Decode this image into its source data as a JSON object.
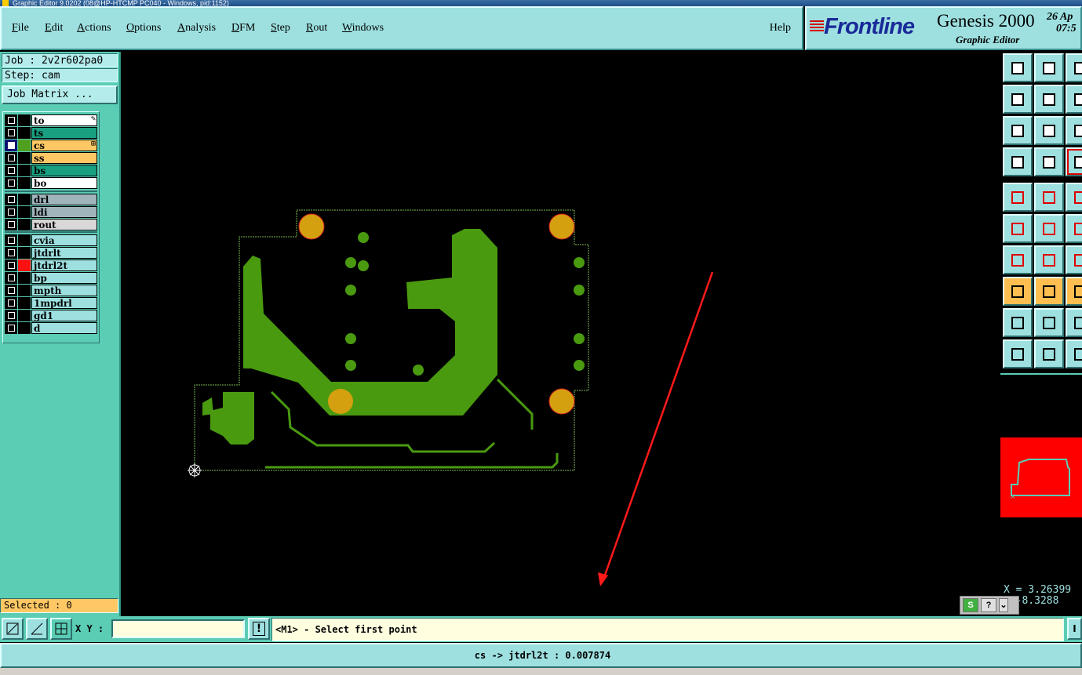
{
  "window": {
    "title": "Graphic Editor 9.0202 (08@HP-HTCMP PC040 - Windows, pid:1152)"
  },
  "menu": {
    "items": [
      "File",
      "Edit",
      "Actions",
      "Options",
      "Analysis",
      "DFM",
      "Step",
      "Rout",
      "Windows"
    ],
    "help": "Help"
  },
  "brand": {
    "logo": "Frontline",
    "title": "Genesis 2000",
    "subtitle": "Graphic Editor",
    "date": "26 Ap",
    "time": "07:5"
  },
  "job": {
    "job_line": "Job : 2v2r602pa0",
    "step_line": "Step: cam",
    "matrix_button": "Job Matrix ..."
  },
  "layers": {
    "group1": [
      {
        "name": "to",
        "bg": "#ffffff",
        "color": "#000000",
        "checked": false,
        "mark": "✎"
      },
      {
        "name": "ts",
        "bg": "#18a080",
        "color": "#000000",
        "checked": false,
        "mark": ""
      },
      {
        "name": "cs",
        "bg": "#ffc864",
        "color": "#50a020",
        "checked": true,
        "mark": "⊞"
      },
      {
        "name": "ss",
        "bg": "#ffc864",
        "color": "#000000",
        "checked": false,
        "mark": ""
      },
      {
        "name": "bs",
        "bg": "#18a080",
        "color": "#000000",
        "checked": false,
        "mark": ""
      },
      {
        "name": "bo",
        "bg": "#ffffff",
        "color": "#000000",
        "checked": false,
        "mark": ""
      }
    ],
    "group2": [
      {
        "name": "drl",
        "bg": "#a0b4bc",
        "color": "#000000",
        "checked": false,
        "mark": ""
      },
      {
        "name": "ldi",
        "bg": "#a0b4bc",
        "color": "#000000",
        "checked": false,
        "mark": ""
      },
      {
        "name": "rout",
        "bg": "#d8d8d8",
        "color": "#000000",
        "checked": false,
        "mark": ""
      }
    ],
    "group3": [
      {
        "name": "cvia",
        "bg": "#9ee0e0",
        "color": "#000000",
        "checked": false,
        "mark": ""
      },
      {
        "name": "jtdrlt",
        "bg": "#9ee0e0",
        "color": "#000000",
        "checked": false,
        "mark": ""
      },
      {
        "name": "jtdrl2t",
        "bg": "#9ee0e0",
        "color": "#ff1010",
        "checked": false,
        "mark": ""
      },
      {
        "name": "bp",
        "bg": "#9ee0e0",
        "color": "#000000",
        "checked": false,
        "mark": ""
      },
      {
        "name": "mpth",
        "bg": "#9ee0e0",
        "color": "#000000",
        "checked": false,
        "mark": ""
      },
      {
        "name": "1mpdrl",
        "bg": "#9ee0e0",
        "color": "#000000",
        "checked": false,
        "mark": ""
      },
      {
        "name": "gd1",
        "bg": "#9ee0e0",
        "color": "#000000",
        "checked": false,
        "mark": ""
      },
      {
        "name": "d",
        "bg": "#9ee0e0",
        "color": "#000000",
        "checked": false,
        "mark": ""
      }
    ]
  },
  "selected": "Selected : 0",
  "coords": {
    "x": "X = 3.26399",
    "y": "= -8.3288"
  },
  "status": {
    "xy_label": "X Y :",
    "xy_value": "",
    "prompt": "<M1> - Select first point",
    "bottom": "cs -> jtdrl2t : 0.007874"
  },
  "tray": {
    "s": "S",
    "q": "?"
  },
  "colors": {
    "copper": "#4a9a10",
    "pad": "#d4a010",
    "outline": "#7ab850",
    "annotation": "#ff1a1a",
    "panel": "#5acdb4",
    "menu": "#9ee0e0"
  }
}
